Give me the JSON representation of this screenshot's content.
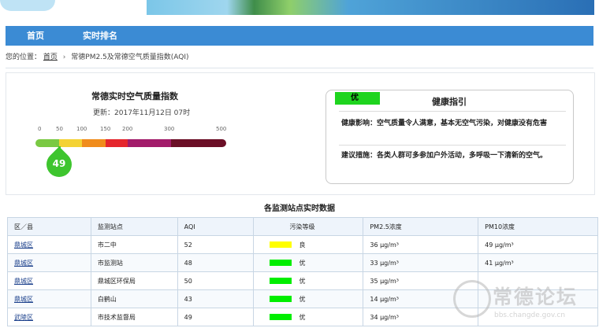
{
  "nav": {
    "items": [
      "首页",
      "实时排名"
    ]
  },
  "breadcrumb": {
    "prefix": "您的位置：",
    "home": "首页",
    "current": "常德PM2.5及常德空气质量指数(AQI)"
  },
  "aqi": {
    "title": "常德实时空气质量指数",
    "update_label": "更新：",
    "update_time": "2017年11月12日 07时",
    "value": "49",
    "scale_labels": [
      "0",
      "50",
      "100",
      "150",
      "200",
      "300",
      "500"
    ],
    "scale_colors": [
      "#7ac943",
      "#f4d234",
      "#f08c1c",
      "#e5262d",
      "#a21c6a",
      "#6b0f26"
    ]
  },
  "health": {
    "level": "优",
    "level_color": "#1ed41e",
    "title": "健康指引",
    "effect": "健康影响：空气质量令人满意，基本无空气污染，对健康没有危害",
    "advice": "建议措施：各类人群可多参加户外活动，多呼吸一下清新的空气。"
  },
  "stations": {
    "title": "各监测站点实时数据",
    "headers": [
      "区／县",
      "监测站点",
      "AQI",
      "污染等级",
      "PM2.5浓度",
      "PM10浓度"
    ],
    "rows": [
      {
        "district": "鼎城区",
        "station": "市二中",
        "aqi": "52",
        "level": "良",
        "level_color": "#ffff00",
        "pm25": "36 μg/m³",
        "pm10": "49 μg/m³"
      },
      {
        "district": "鼎城区",
        "station": "市监测站",
        "aqi": "48",
        "level": "优",
        "level_color": "#00ee00",
        "pm25": "33 μg/m³",
        "pm10": "41 μg/m³"
      },
      {
        "district": "鼎城区",
        "station": "鼎城区环保局",
        "aqi": "50",
        "level": "优",
        "level_color": "#00ee00",
        "pm25": "35 μg/m³",
        "pm10": ""
      },
      {
        "district": "鼎城区",
        "station": "白鹤山",
        "aqi": "43",
        "level": "优",
        "level_color": "#00ee00",
        "pm25": "14 μg/m³",
        "pm10": ""
      },
      {
        "district": "武陵区",
        "station": "市技术监督局",
        "aqi": "49",
        "level": "优",
        "level_color": "#00ee00",
        "pm25": "34 μg/m³",
        "pm10": ""
      }
    ]
  },
  "watermark": {
    "text": "常德论坛",
    "url": "bbs.changde.gov.cn"
  }
}
